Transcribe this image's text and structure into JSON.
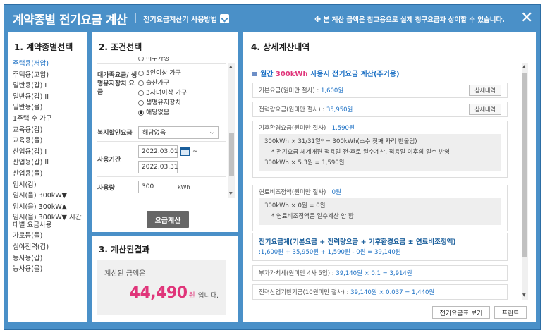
{
  "header": {
    "title": "계약종별 전기요금 계산",
    "howto": "전기요금계산기 사용방법",
    "notice": "※ 본 계산 금액은 참고용으로 실제 청구요금과 상이할 수 있습니다.",
    "close": "✕"
  },
  "colors": {
    "frame": "#4a90c8",
    "accent": "#1a6fc4",
    "highlight": "#e0357a"
  },
  "contract": {
    "heading": "1. 계약종별선택",
    "items": [
      "주택용(저압)",
      "주택용(고압)",
      "일반용(갑) I",
      "일반용(갑) II",
      "일반용(을)",
      "1주택 수 가구",
      "교육용(갑)",
      "교육용(을)",
      "산업용(갑) I",
      "산업용(갑) II",
      "산업용(을)",
      "임시(갑)",
      "임시(을) 300kW▼",
      "임시(을) 300kW▲",
      "임시(을) 300kW▼ 시간대별 요금사용",
      "가로등(을)",
      "심야전력(갑)",
      "농사용(갑)",
      "농사용(을)"
    ],
    "selected": "주택용(저압)"
  },
  "conditions": {
    "heading": "2. 조건선택",
    "cutoff_option": "미수가정",
    "family_label": "대가족요금/ 생명유지장치 요금",
    "family_options": [
      "5인이상 가구",
      "출산가구",
      "3자녀이상 가구",
      "생명유지장치",
      "해당없음"
    ],
    "family_selected": "해당없음",
    "welfare_label": "복지할인요금",
    "welfare_value": "해당없음",
    "period_label": "사용기간",
    "period_from": "2022.03.01",
    "period_tilde": "~",
    "period_to": "2022.03.31",
    "usage_label": "사용량",
    "usage_value": "300",
    "usage_unit": "kWh",
    "calc_button": "요금계산"
  },
  "result": {
    "heading": "3. 계산된결과",
    "label": "계산된 금액은",
    "amount": "44,490",
    "unit": "원",
    "suffix": "입니다."
  },
  "detail": {
    "heading": "4. 상세계산내역",
    "title_pre": "월간",
    "title_kwh": "300kWh",
    "title_post": "사용시 전기요금 계산(주거용)",
    "base_label": "기본요금(원미만 절사) :",
    "base_value": "1,600원",
    "energy_label": "전력량요금(원미만 절사) :",
    "energy_value": "35,950원",
    "detail_button": "상세내역",
    "climate_label": "기후환경요금(원미만 절사) :",
    "climate_value": "1,590원",
    "climate_lines": [
      "300kWh × 31/31일* = 300kWh(소수 첫째 자리 반올림)",
      "* 전기요금 체계개편 적용일 전·후로 일수계산, 적용일 이후의 일수 반영",
      "300kWh × 5.3원 = 1,590원"
    ],
    "fuel_label": "연료비조정액(원미만 절사) :",
    "fuel_value": "0원",
    "fuel_lines": [
      "300kWh × 0원 = 0원",
      "* 연료비조정액은 일수계산 안 함"
    ],
    "sum_title": "전기요금계(기본요금 + 전력량요금 + 기후환경요금 ± 연료비조정액)",
    "sum_value": ":1,600원 + 35,950원 + 1,590원 - 0원 = 39,140원",
    "vat_label": "부가가치세(원미만 4사 5입) :",
    "vat_value": "39,140원 × 0.1 = 3,914원",
    "fund_label": "전력산업기반기금(10원미만 절사) :",
    "fund_value": "39,140원 × 0.037 = 1,440원",
    "table_button": "전기요금표 보기",
    "print_button": "프린트"
  }
}
